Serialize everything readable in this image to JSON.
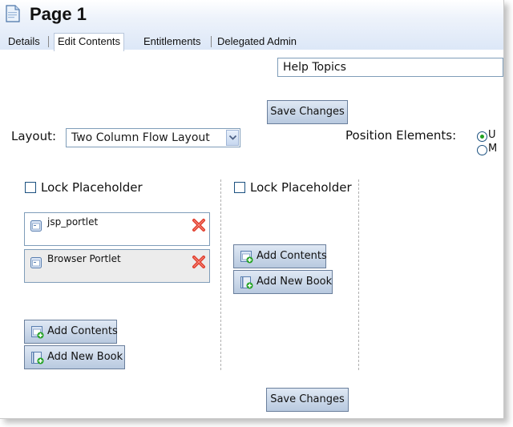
{
  "page": {
    "title": "Page 1"
  },
  "tabs": [
    {
      "label": "Details",
      "active": false
    },
    {
      "label": "Edit Contents",
      "active": true
    },
    {
      "label": "Entitlements",
      "active": false
    },
    {
      "label": "Delegated Admin",
      "active": false
    }
  ],
  "help": {
    "selected": "Help Topics"
  },
  "actions": {
    "save_label": "Save Changes"
  },
  "layout": {
    "label": "Layout:",
    "selected": "Two Column Flow Layout"
  },
  "position": {
    "label": "Position Elements:",
    "options": [
      "U",
      "M"
    ],
    "selected_index": 0
  },
  "columns": [
    {
      "lock_label": "Lock Placeholder",
      "portlets": [
        {
          "name": "jsp_portlet"
        },
        {
          "name": "Browser Portlet"
        }
      ],
      "add_contents_label": "Add Contents",
      "add_book_label": "Add New Book"
    },
    {
      "lock_label": "Lock Placeholder",
      "portlets": [],
      "add_contents_label": "Add Contents",
      "add_book_label": "Add New Book"
    }
  ],
  "colors": {
    "accent": "#21a121",
    "header": "#dce7f7",
    "delete": "#e03c2b",
    "button": "#b8c9df"
  }
}
